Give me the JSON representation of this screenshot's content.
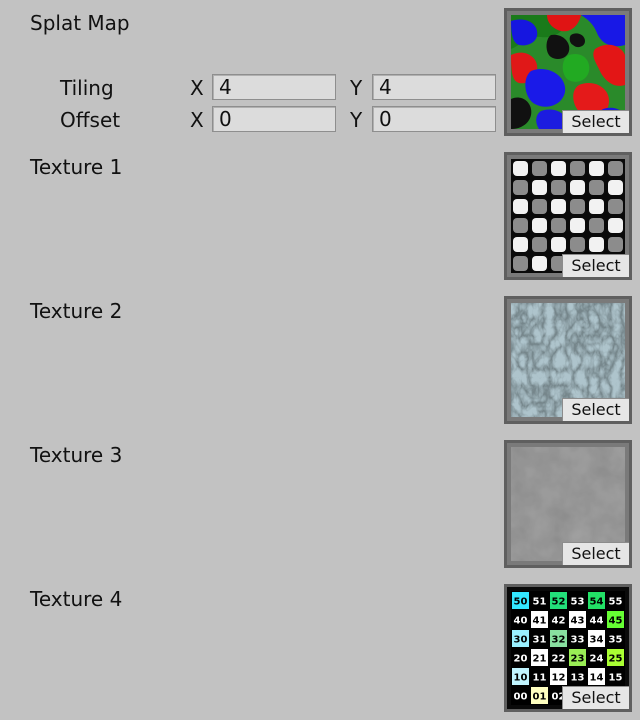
{
  "splat": {
    "title": "Splat Map",
    "tiling_label": "Tiling",
    "offset_label": "Offset",
    "tiling_x_axis": "X",
    "tiling_y_axis": "Y",
    "offset_x_axis": "X",
    "offset_y_axis": "Y",
    "tiling_x": "4",
    "tiling_y": "4",
    "offset_x": "0",
    "offset_y": "0",
    "select_label": "Select"
  },
  "textures": [
    {
      "label": "Texture 1",
      "select_label": "Select"
    },
    {
      "label": "Texture 2",
      "select_label": "Select"
    },
    {
      "label": "Texture 3",
      "select_label": "Select"
    },
    {
      "label": "Texture 4",
      "select_label": "Select"
    }
  ],
  "grid_thumb": {
    "rows": [
      [
        "50",
        "51",
        "52",
        "53",
        "54",
        "55"
      ],
      [
        "40",
        "41",
        "42",
        "43",
        "44",
        "45"
      ],
      [
        "30",
        "31",
        "32",
        "33",
        "34",
        "35"
      ],
      [
        "20",
        "21",
        "22",
        "23",
        "24",
        "25"
      ],
      [
        "10",
        "11",
        "12",
        "13",
        "14",
        "15"
      ],
      [
        "00",
        "01",
        "02",
        "03",
        "04",
        "05"
      ]
    ],
    "highlights": {
      "50": "#33e6ff",
      "52": "#22e07a",
      "54": "#22e066",
      "41": "#ffffff",
      "43": "#ffffff",
      "45": "#66ff33",
      "30": "#99f0ff",
      "32": "#88e0a0",
      "34": "#ffffff",
      "21": "#ffffff",
      "23": "#99ee55",
      "25": "#aaff33",
      "10": "#c0f4ff",
      "12": "#ffffff",
      "14": "#ffffff",
      "01": "#ffffc0"
    }
  }
}
